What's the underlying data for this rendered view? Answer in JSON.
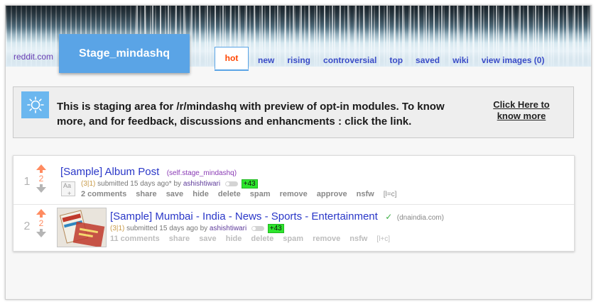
{
  "header": {
    "site_link": "reddit.com",
    "subreddit_title": "Stage_mindashq",
    "tabs": [
      {
        "label": "hot",
        "active": true
      },
      {
        "label": "new",
        "active": false
      },
      {
        "label": "rising",
        "active": false
      },
      {
        "label": "controversial",
        "active": false
      },
      {
        "label": "top",
        "active": false
      },
      {
        "label": "saved",
        "active": false
      },
      {
        "label": "wiki",
        "active": false
      },
      {
        "label": "view images (0)",
        "active": false
      }
    ]
  },
  "announcement": {
    "icon": "sun-icon",
    "text": "This is staging area for /r/mindashq with preview of opt-in modules. To know more, and for feedback, discussions and enhancments : click the link.",
    "cta_line1": "Click Here to",
    "cta_line2": "know more"
  },
  "posts": [
    {
      "rank": "1",
      "score": "2",
      "title": "[Sample] Album Post",
      "domain": "(self.stage_mindashq)",
      "verified": false,
      "thumb_label": "Aa",
      "vote_counts": "(3|1)",
      "submitted": "submitted 15 days ago* by",
      "author": "ashishtiwari",
      "karma": "+43",
      "comments": "2 comments",
      "actions": [
        "share",
        "save",
        "hide",
        "delete",
        "spam",
        "remove",
        "approve",
        "nsfw"
      ],
      "flair": "[l=c]"
    },
    {
      "rank": "2",
      "score": "2",
      "title": "[Sample] Mumbai - India - News - Sports - Entertainment",
      "domain": "(dnaindia.com)",
      "verified": true,
      "vote_counts": "(3|1)",
      "submitted": "submitted 15 days ago by",
      "author": "ashishtiwari",
      "karma": "+43",
      "comments": "11 comments",
      "actions": [
        "share",
        "save",
        "hide",
        "delete",
        "spam",
        "remove",
        "nsfw"
      ],
      "flair": "[l+c]"
    }
  ],
  "colors": {
    "accent": "#5aa4e6",
    "upvote": "#ff8b60",
    "link": "#2a37c8",
    "karma_badge": "#2ee52e"
  }
}
